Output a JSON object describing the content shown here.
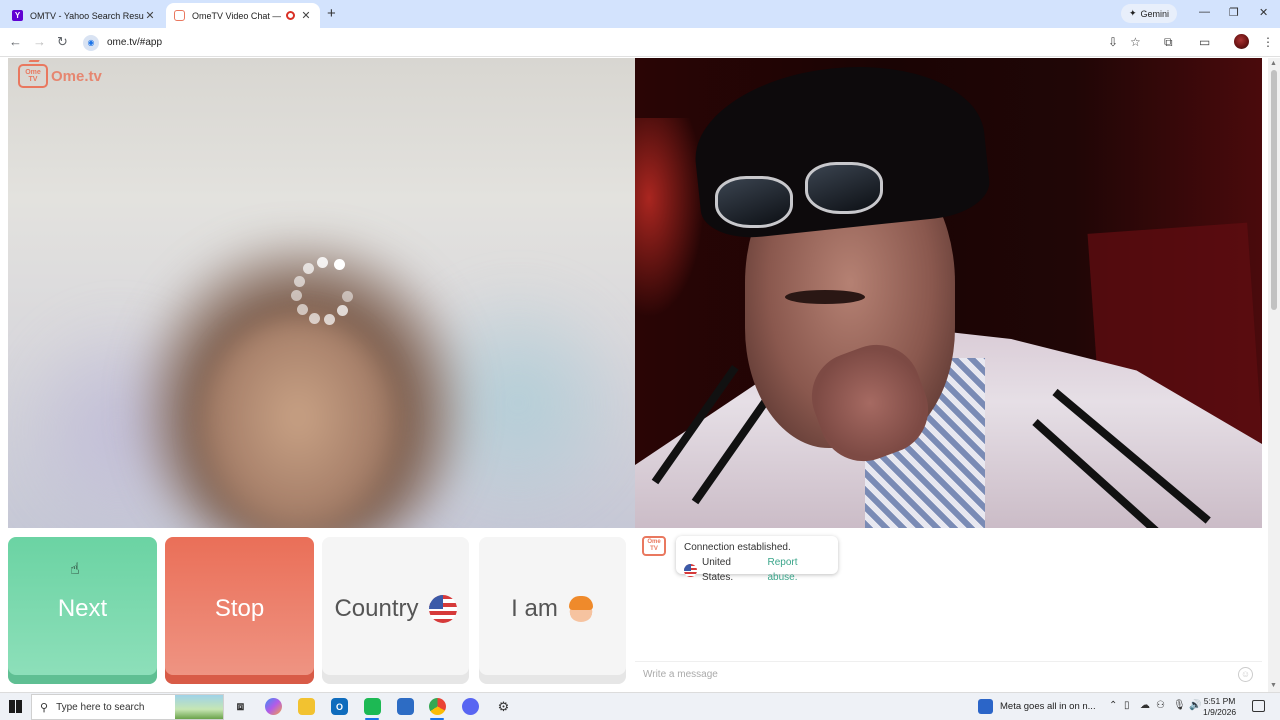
{
  "browser": {
    "tabs": [
      {
        "title": "OMTV - Yahoo Search Results",
        "favicon": "yahoo-icon",
        "active": false
      },
      {
        "title": "OmeTV Video Chat — Ome",
        "favicon": "ometv-icon",
        "active": true
      }
    ],
    "gemini_label": "Gemini",
    "url": "ome.tv/#app"
  },
  "app": {
    "logo_text": "Ome.tv",
    "logo_tv_text": "Ome TV",
    "buttons": {
      "next": "Next",
      "stop": "Stop",
      "country": "Country",
      "i_am": "I am"
    },
    "chat": {
      "messages": [
        {
          "line1": "Connection established.",
          "country": "United States.",
          "link": "Report abuse."
        }
      ],
      "input_placeholder": "Write a message"
    }
  },
  "taskbar": {
    "search_placeholder": "Type here to search",
    "news_text": "Meta goes all in on n...",
    "time": "5:51 PM",
    "date": "1/9/2026"
  },
  "colors": {
    "next": "#6bd3a3",
    "stop": "#ea6f58",
    "brand": "#e9785f",
    "link": "#3aa58a",
    "tabstrip": "#d3e3fd"
  }
}
